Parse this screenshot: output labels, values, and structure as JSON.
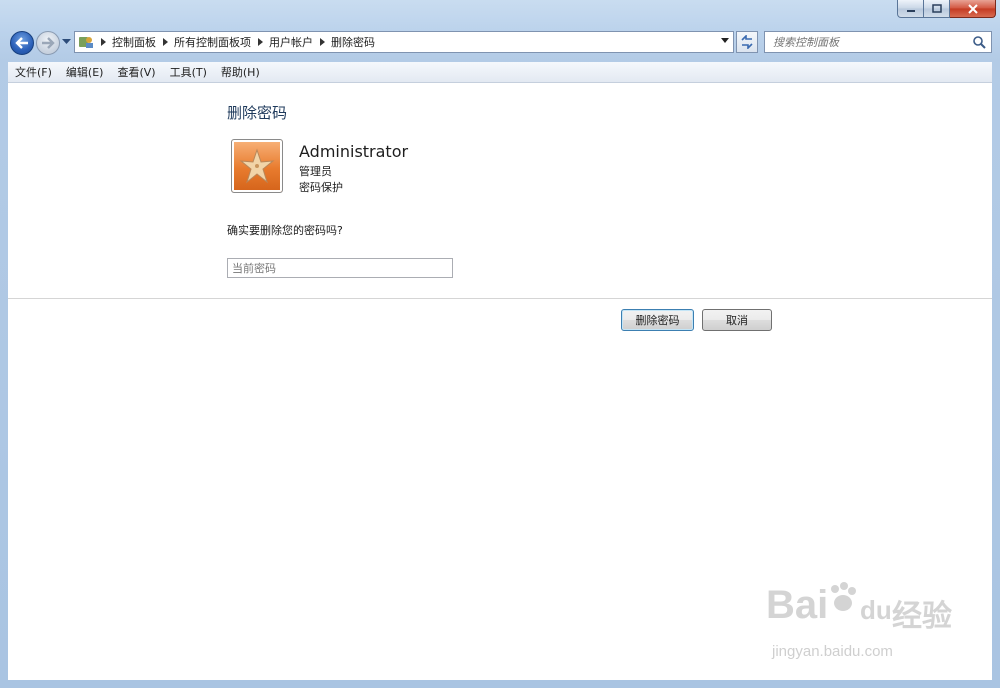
{
  "window": {
    "controls": {
      "minimize": "minimize-icon",
      "maximize": "maximize-icon",
      "close": "close-icon"
    }
  },
  "nav": {
    "breadcrumbs": [
      "控制面板",
      "所有控制面板项",
      "用户帐户",
      "删除密码"
    ],
    "search_placeholder": "搜索控制面板"
  },
  "menu": {
    "items": [
      "文件(F)",
      "编辑(E)",
      "查看(V)",
      "工具(T)",
      "帮助(H)"
    ]
  },
  "page": {
    "title": "删除密码",
    "user": {
      "name": "Administrator",
      "role": "管理员",
      "status": "密码保护"
    },
    "question": "确实要删除您的密码吗?",
    "password_placeholder": "当前密码",
    "buttons": {
      "confirm": "删除密码",
      "cancel": "取消"
    }
  },
  "watermark": {
    "brand": "Bai",
    "brand2": "du",
    "brand_cn": "经验",
    "url": "jingyan.baidu.com"
  },
  "colors": {
    "heading": "#1e395b",
    "accent_border": "#3c7fb1",
    "avatar": "#e87b2e"
  }
}
